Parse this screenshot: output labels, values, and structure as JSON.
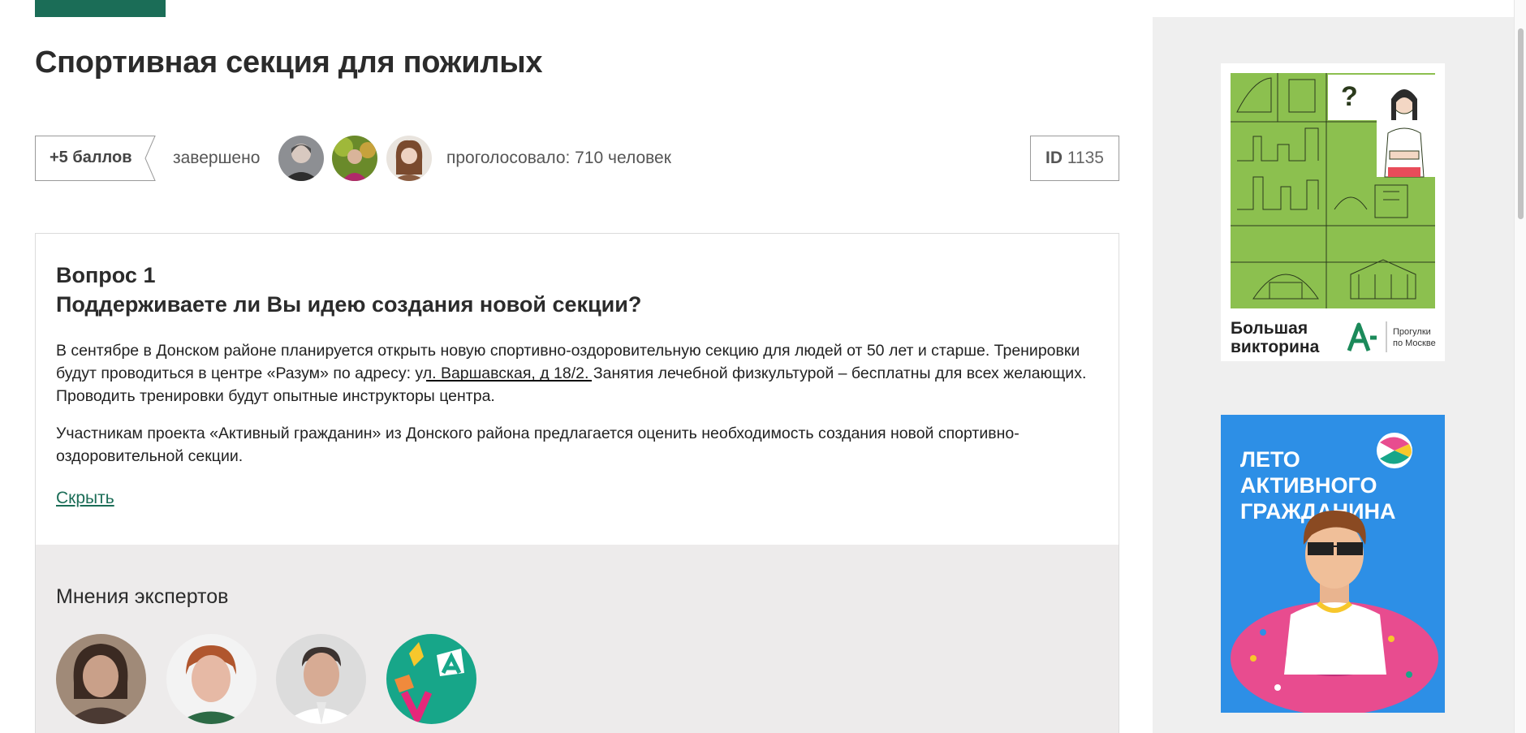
{
  "header": {
    "title": "Спортивная секция для пожилых"
  },
  "meta": {
    "points": "+5 баллов",
    "status": "завершено",
    "votes": "проголосовало: 710 человек",
    "id_label": "ID",
    "id_value": "1135"
  },
  "question": {
    "number": "Вопрос 1",
    "title": "Поддерживаете ли Вы идею создания новой секции?",
    "p1_a": "В сентябре в Донском районе планируется открыть новую спортивно-оздоровительную секцию для людей от 50 лет и старше. Тренировки будут проводиться в центре «Разум» по адресу: ",
    "p1_address": "ул. Варшавская, д 18/2.",
    "p1_b": " Занятия лечебной физкультурой – бесплатны для всех желающих. Проводить тренировки будут опытные инструкторы центра.",
    "p2": "Участникам проекта «Активный гражданин» из Донского района предлагается оценить необходимость создания новой спортивно-оздоровительной секции.",
    "hide_link": "Скрыть"
  },
  "experts": {
    "title": "Мнения экспертов"
  },
  "sidebar": {
    "ad1": {
      "title_line1": "Большая",
      "title_line2": "викторина",
      "sub_line1": "Прогулки",
      "sub_line2": "по Москве"
    },
    "ad2": {
      "line1": "ЛЕТО",
      "line2": "АКТИВНОГО",
      "line3": "ГРАЖДАНИНА"
    }
  },
  "colors": {
    "brand": "#1b6d57",
    "ad_green": "#8cc04f",
    "ad_blue": "#2d8fe6",
    "ring_pink": "#e84c8f"
  }
}
